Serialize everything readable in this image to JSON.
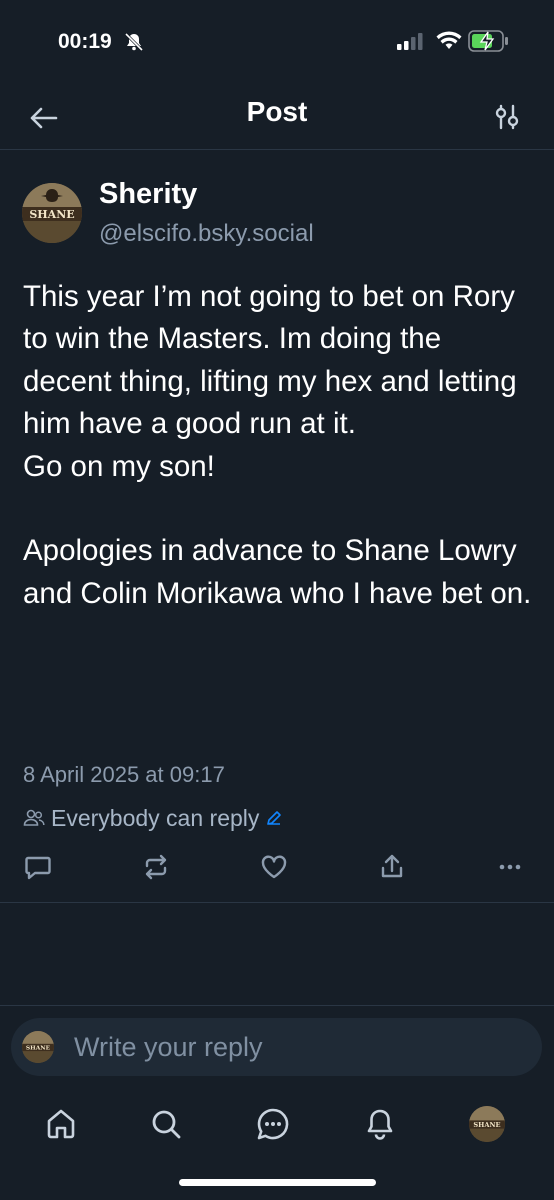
{
  "status": {
    "time": "00:19"
  },
  "header": {
    "title": "Post",
    "icons": {
      "back": "arrow-left-icon",
      "settings": "sliders-icon"
    }
  },
  "post": {
    "author_name": "Sherity",
    "author_handle": "@elscifo.bsky.social",
    "avatar_text": "SHANE",
    "text": "This year I’m not going to bet on Rory to win the Masters. Im doing the decent thing, lifting my hex and letting him have a good run at it.\nGo on my son!\n\nApologies in advance to Shane Lowry and Colin Morikawa who I have bet on.",
    "timestamp": "8 April 2025 at 09:17",
    "reply_setting": "Everybody can reply"
  },
  "actions": [
    "reply-icon",
    "repost-icon",
    "like-icon",
    "share-icon",
    "more-icon"
  ],
  "composer": {
    "placeholder": "Write your reply"
  },
  "nav": [
    "home-icon",
    "search-icon",
    "chat-icon",
    "notifications-icon",
    "profile-avatar"
  ],
  "colors": {
    "background": "#161e27",
    "muted": "#8c9bad",
    "accent": "#1185fe"
  }
}
